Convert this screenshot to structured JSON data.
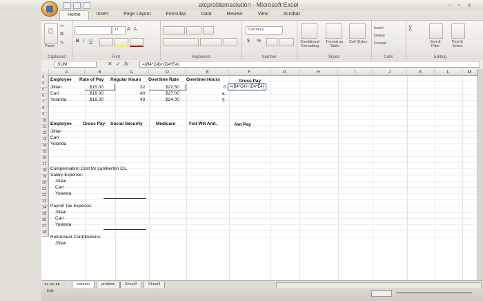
{
  "window": {
    "title": "atcproblemsolution - Microsoft Excel",
    "controls": [
      "-",
      "▫",
      "x"
    ]
  },
  "tabs": [
    "Home",
    "Insert",
    "Page Layout",
    "Formulas",
    "Data",
    "Review",
    "View",
    "Acrobat"
  ],
  "ribbon": {
    "clipboard": {
      "label": "Clipboard",
      "paste": "Paste"
    },
    "font": {
      "label": "Font",
      "size": "11",
      "bold": "B",
      "italic": "I",
      "underline": "U",
      "grow": "A",
      "shrink": "A"
    },
    "alignment": {
      "label": "Alignment"
    },
    "number": {
      "label": "Number",
      "format": "Currency",
      "dollar": "$",
      "percent": "%"
    },
    "styles": {
      "label": "Styles",
      "conditional": "Conditional Formatting",
      "format_table": "Format as Table",
      "cell_styles": "Cell Styles"
    },
    "cells": {
      "label": "Cells",
      "insert": "Insert",
      "delete": "Delete",
      "format": "Format"
    },
    "editing": {
      "label": "Editing",
      "sum": "Σ",
      "sort": "Sort & Filter",
      "find": "Find & Select"
    }
  },
  "formula_bar": {
    "name_box": "SUM",
    "cancel": "✕",
    "enter": "✓",
    "fx": "fx",
    "formula": "=(B4*C4)+(D4*E4)"
  },
  "columns": [
    "A",
    "B",
    "C",
    "D",
    "E",
    "F",
    "G",
    "H",
    "I",
    "J",
    "K",
    "L",
    "M"
  ],
  "rows": {
    "r3": {
      "a": "Employee",
      "b": "Rate of Pay",
      "c": "Regular Hours",
      "d": "Overtime Rate",
      "e": "Overtime Hours",
      "f": "Gross Pay"
    },
    "r4": {
      "a": "Jillian",
      "b": "$15.00",
      "c": "32",
      "d": "$22.50",
      "e": "0",
      "f": "=(B4*C4)+(D4*E4)"
    },
    "r5": {
      "a": "Carl",
      "b": "$18.00",
      "c": "40",
      "d": "$27.00",
      "e": "6"
    },
    "r6": {
      "a": "Yolanda",
      "b": "$16.00",
      "c": "40",
      "d": "$24.00",
      "e": "5"
    },
    "r9": {
      "a": "Employee",
      "b": "Gross Pay",
      "c": "Social Security",
      "d": "Medicare",
      "e": "Fed WH Amt.",
      "f": "Net Pay"
    },
    "r10": {
      "a": "Jillian"
    },
    "r11": {
      "a": "Carl"
    },
    "r12": {
      "a": "Yolanda"
    },
    "r15": {
      "a": "Compensation Cost for Lumberton Co."
    },
    "r16": {
      "a": "Salary Expense:"
    },
    "r17": {
      "a": "Jillian"
    },
    "r18": {
      "a": "Carl"
    },
    "r19": {
      "a": "Yolanda"
    },
    "r21": {
      "a": "Payroll Tax Expense:"
    },
    "r22": {
      "a": "Jillian"
    },
    "r23": {
      "a": "Carl"
    },
    "r24": {
      "a": "Yolanda"
    },
    "r26": {
      "a": "Retirement Contributions:"
    },
    "r27": {
      "a": "Jillian"
    }
  },
  "row_numbers": [
    "3",
    "4",
    "5",
    "6",
    "7",
    "8",
    "9",
    "10",
    "11",
    "12",
    "13",
    "14",
    "15",
    "16",
    "17",
    "18",
    "19",
    "20",
    "21",
    "22",
    "23",
    "24",
    "25",
    "26",
    "27",
    "28"
  ],
  "sheet_tabs": [
    "solution",
    "problem",
    "Sheet2",
    "Sheet3"
  ],
  "status": "Edit"
}
